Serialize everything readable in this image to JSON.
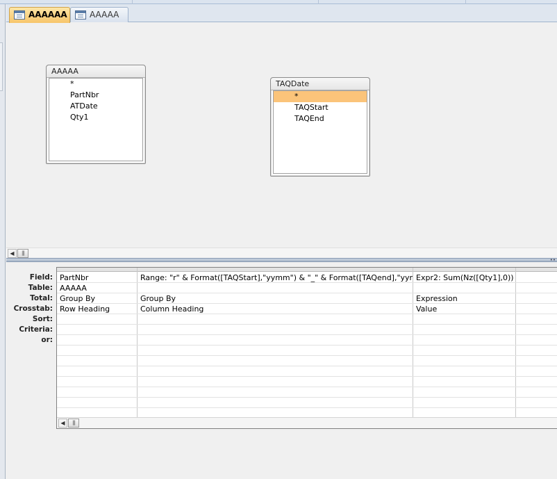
{
  "tabs": [
    {
      "label": "AAAAAA",
      "active": true
    },
    {
      "label": "AAAAA",
      "active": false
    }
  ],
  "field_lists": [
    {
      "title": "AAAAA",
      "fields": [
        "*",
        "PartNbr",
        "ATDate",
        "Qty1"
      ],
      "selected_index": -1
    },
    {
      "title": "TAQDate",
      "fields": [
        "*",
        "TAQStart",
        "TAQEnd"
      ],
      "selected_index": 0
    }
  ],
  "grid": {
    "row_labels": [
      "Field:",
      "Table:",
      "Total:",
      "Crosstab:",
      "Sort:",
      "Criteria:",
      "or:"
    ],
    "columns": [
      {
        "field": "PartNbr",
        "table": "AAAAA",
        "total": "Group By",
        "crosstab": "Row Heading",
        "sort": "",
        "criteria": "",
        "or": ""
      },
      {
        "field": "Range: \"r\" & Format([TAQStart],\"yymm\") & \"_\" & Format([TAQend],\"yymm\")",
        "table": "",
        "total": "Group By",
        "crosstab": "Column Heading",
        "sort": "",
        "criteria": "",
        "or": ""
      },
      {
        "field": "Expr2: Sum(Nz([Qty1],0))",
        "table": "",
        "total": "Expression",
        "crosstab": "Value",
        "sort": "",
        "criteria": "",
        "or": ""
      },
      {
        "field": "",
        "table": "",
        "total": "",
        "crosstab": "",
        "sort": "",
        "criteria": "",
        "or": ""
      }
    ]
  },
  "colors": {
    "active_tab": "#f7c56a",
    "selected_field": "#fbc47a"
  }
}
